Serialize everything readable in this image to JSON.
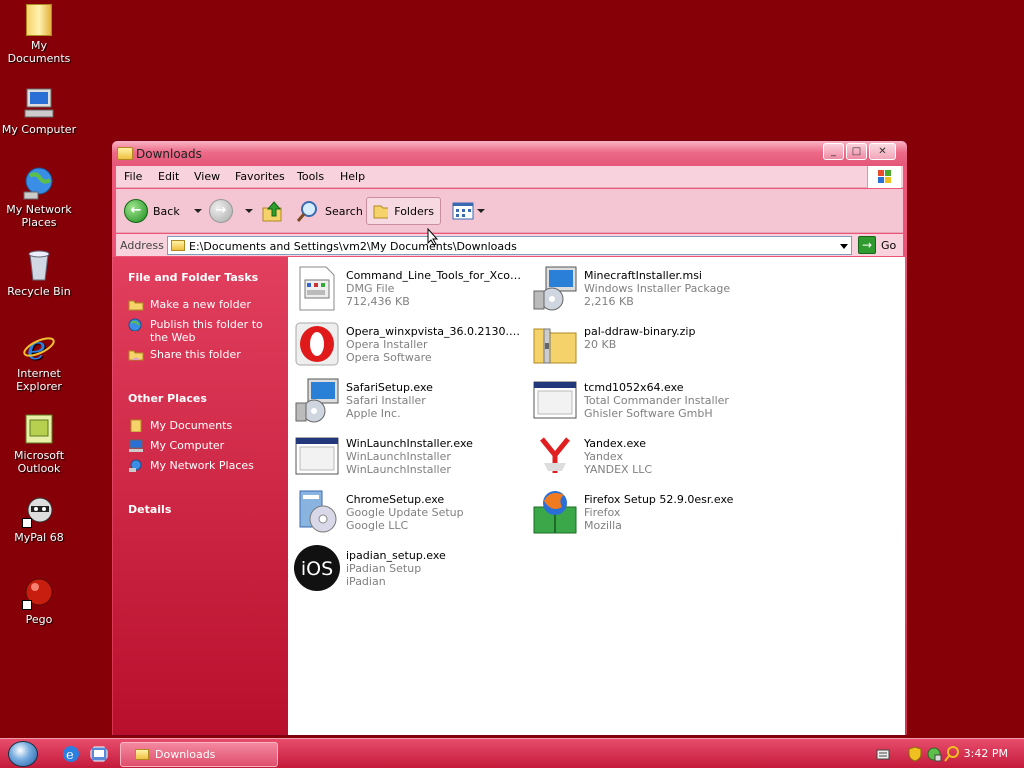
{
  "desktop": {
    "icons": [
      {
        "label": "My Documents"
      },
      {
        "label": "My Computer"
      },
      {
        "label": "My Network Places"
      },
      {
        "label": "Recycle Bin"
      },
      {
        "label": "Internet Explorer"
      },
      {
        "label": "Microsoft Outlook"
      },
      {
        "label": "MyPal 68"
      },
      {
        "label": "Pego"
      }
    ]
  },
  "window": {
    "title": "Downloads",
    "controls": {
      "minimize": "_",
      "maximize": "□",
      "close": "✕"
    },
    "menu": [
      "File",
      "Edit",
      "View",
      "Favorites",
      "Tools",
      "Help"
    ],
    "toolbar": {
      "back": "Back",
      "search": "Search",
      "folders": "Folders"
    },
    "address": {
      "label": "Address",
      "path": "E:\\Documents and Settings\\vm2\\My Documents\\Downloads",
      "go": "Go"
    },
    "taskpane": {
      "file_tasks_title": "File and Folder Tasks",
      "file_tasks": [
        "Make a new folder",
        "Publish this folder to the Web",
        "Share this folder"
      ],
      "other_places_title": "Other Places",
      "other_places": [
        "My Documents",
        "My Computer",
        "My Network Places"
      ],
      "details_title": "Details"
    },
    "files": [
      {
        "name": "Command_Line_Tools_for_Xcode...",
        "line2": "DMG File",
        "line3": "712,436 KB",
        "icon": "dmg-file-icon"
      },
      {
        "name": "MinecraftInstaller.msi",
        "line2": "Windows Installer Package",
        "line3": "2,216 KB",
        "icon": "msi-installer-icon"
      },
      {
        "name": "Opera_winxpvista_36.0.2130.80_...",
        "line2": "Opera Installer",
        "line3": "Opera Software",
        "icon": "opera-icon"
      },
      {
        "name": "pal-ddraw-binary.zip",
        "line2": "20 KB",
        "line3": "",
        "icon": "zip-folder-icon"
      },
      {
        "name": "SafariSetup.exe",
        "line2": "Safari Installer",
        "line3": "Apple Inc.",
        "icon": "safari-setup-icon"
      },
      {
        "name": "tcmd1052x64.exe",
        "line2": "Total Commander Installer",
        "line3": "Ghisler Software GmbH",
        "icon": "exe-window-icon"
      },
      {
        "name": "WinLaunchInstaller.exe",
        "line2": "WinLaunchInstaller",
        "line3": "WinLaunchInstaller",
        "icon": "exe-window-icon"
      },
      {
        "name": "Yandex.exe",
        "line2": "Yandex",
        "line3": "YANDEX LLC",
        "icon": "yandex-icon"
      },
      {
        "name": "ChromeSetup.exe",
        "line2": "Google Update Setup",
        "line3": "Google LLC",
        "icon": "chrome-setup-icon"
      },
      {
        "name": "Firefox Setup 52.9.0esr.exe",
        "line2": "Firefox",
        "line3": "Mozilla",
        "icon": "firefox-setup-icon"
      },
      {
        "name": "ipadian_setup.exe",
        "line2": "iPadian Setup",
        "line3": "iPadian",
        "icon": "ipadian-ios-icon"
      }
    ]
  },
  "taskbar": {
    "task_label": "Downloads",
    "clock": "3:42 PM"
  },
  "ipadian_glyph": "iOS"
}
